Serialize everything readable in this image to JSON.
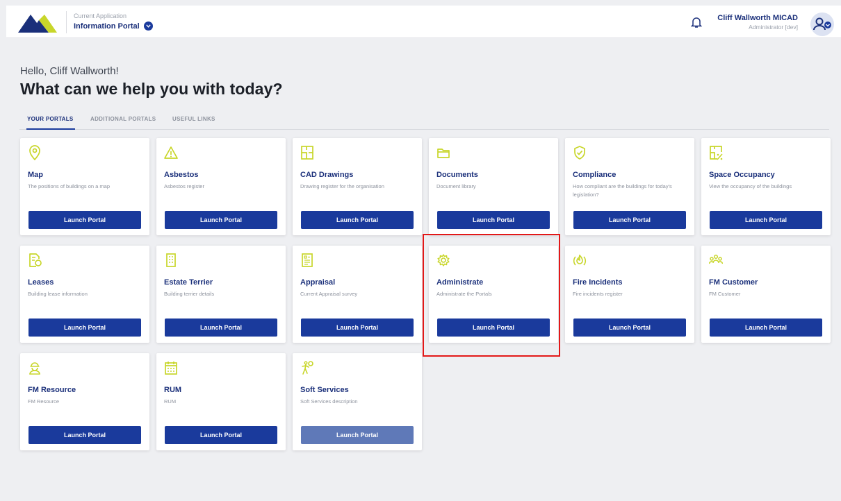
{
  "header": {
    "app_caption": "Current Application",
    "app_name": "Information Portal",
    "user_name": "Cliff Wallworth MICAD",
    "user_role": "Administrator [dev]"
  },
  "greeting": "Hello, Cliff Wallworth!",
  "headline": "What can we help you with today?",
  "tabs": [
    {
      "label": "YOUR PORTALS",
      "active": true
    },
    {
      "label": "ADDITIONAL PORTALS",
      "active": false
    },
    {
      "label": "USEFUL LINKS",
      "active": false
    }
  ],
  "colors": {
    "brand": "#1a3a9c",
    "accent": "#c8d62a",
    "highlight": "#e31818"
  },
  "portals": [
    {
      "title": "Map",
      "desc": "The positions of buildings on a map",
      "button": "Launch Portal",
      "icon": "map-pin-icon"
    },
    {
      "title": "Asbestos",
      "desc": "Asbestos register",
      "button": "Launch Portal",
      "icon": "warning-icon"
    },
    {
      "title": "CAD Drawings",
      "desc": "Drawing register for the organisation",
      "button": "Launch Portal",
      "icon": "floorplan-icon"
    },
    {
      "title": "Documents",
      "desc": "Document library",
      "button": "Launch Portal",
      "icon": "folder-icon"
    },
    {
      "title": "Compliance",
      "desc": "How compliant are the buildings for today's legislation?",
      "button": "Launch Portal",
      "icon": "shield-check-icon"
    },
    {
      "title": "Space Occupancy",
      "desc": "View the occupancy of the buildings",
      "button": "Launch Portal",
      "icon": "floorplan-percent-icon"
    },
    {
      "title": "Leases",
      "desc": "Building lease information",
      "button": "Launch Portal",
      "icon": "lease-document-icon"
    },
    {
      "title": "Estate Terrier",
      "desc": "Building terrier details",
      "button": "Launch Portal",
      "icon": "building-icon"
    },
    {
      "title": "Appraisal",
      "desc": "Current Appraisal survey",
      "button": "Launch Portal",
      "icon": "survey-icon"
    },
    {
      "title": "Administrate",
      "desc": "Administrate the Portals",
      "button": "Launch Portal",
      "icon": "gear-icon"
    },
    {
      "title": "Fire Incidents",
      "desc": "Fire incidents register",
      "button": "Launch Portal",
      "icon": "fire-icon"
    },
    {
      "title": "FM Customer",
      "desc": "FM Customer",
      "button": "Launch Portal",
      "icon": "people-icon"
    },
    {
      "title": "FM Resource",
      "desc": "FM Resource",
      "button": "Launch Portal",
      "icon": "worker-icon"
    },
    {
      "title": "RUM",
      "desc": "RUM",
      "button": "Launch Portal",
      "icon": "calendar-icon"
    },
    {
      "title": "Soft Services",
      "desc": "Soft Services description",
      "button": "Launch Portal",
      "icon": "cleaner-icon",
      "disabled": true
    }
  ]
}
